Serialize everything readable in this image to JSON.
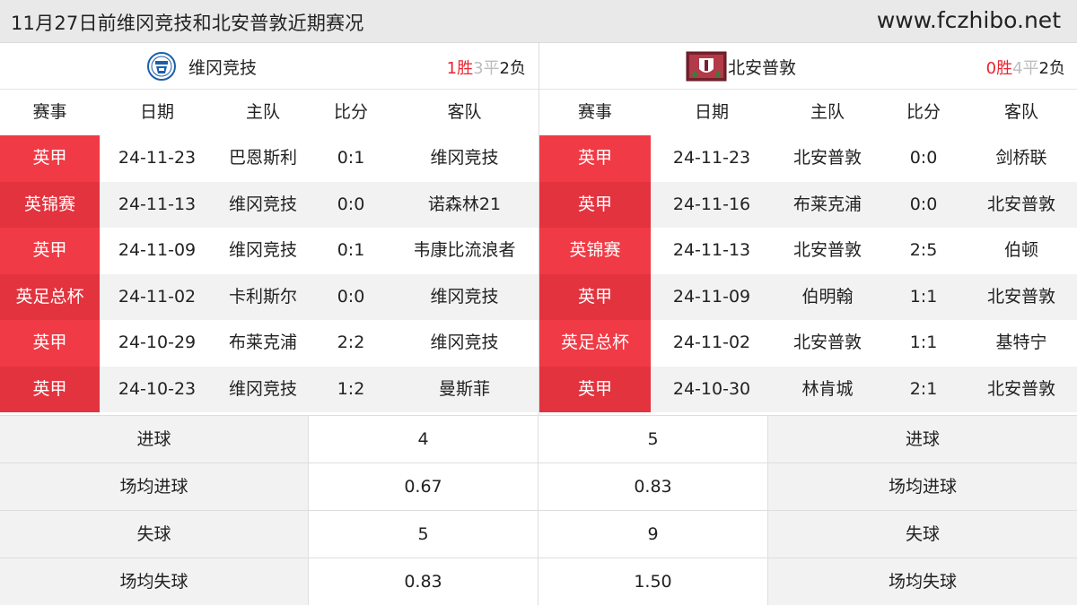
{
  "header": {
    "title": "11月27日前维冈竞技和北安普敦近期赛况",
    "site": "www.fczhibo.net"
  },
  "columns": [
    "赛事",
    "日期",
    "主队",
    "比分",
    "客队"
  ],
  "colors": {
    "league_bg": "#f03a45",
    "win": "#e8262f",
    "draw": "#bdbdbd"
  },
  "left_team": {
    "name": "维冈竞技",
    "logo_icon": "wigan-crest-icon",
    "record": {
      "w": "1",
      "w_label": "胜",
      "d": "3",
      "d_label": "平",
      "l": "2",
      "l_label": "负"
    },
    "matches": [
      {
        "league": "英甲",
        "date": "24-11-23",
        "home": "巴恩斯利",
        "score": "0:1",
        "away": "维冈竞技"
      },
      {
        "league": "英锦赛",
        "date": "24-11-13",
        "home": "维冈竞技",
        "score": "0:0",
        "away": "诺森林21"
      },
      {
        "league": "英甲",
        "date": "24-11-09",
        "home": "维冈竞技",
        "score": "0:1",
        "away": "韦康比流浪者"
      },
      {
        "league": "英足总杯",
        "date": "24-11-02",
        "home": "卡利斯尔",
        "score": "0:0",
        "away": "维冈竞技"
      },
      {
        "league": "英甲",
        "date": "24-10-29",
        "home": "布莱克浦",
        "score": "2:2",
        "away": "维冈竞技"
      },
      {
        "league": "英甲",
        "date": "24-10-23",
        "home": "维冈竞技",
        "score": "1:2",
        "away": "曼斯菲"
      }
    ]
  },
  "right_team": {
    "name": "北安普敦",
    "logo_icon": "northampton-crest-icon",
    "record": {
      "w": "0",
      "w_label": "胜",
      "d": "4",
      "d_label": "平",
      "l": "2",
      "l_label": "负"
    },
    "matches": [
      {
        "league": "英甲",
        "date": "24-11-23",
        "home": "北安普敦",
        "score": "0:0",
        "away": "剑桥联"
      },
      {
        "league": "英甲",
        "date": "24-11-16",
        "home": "布莱克浦",
        "score": "0:0",
        "away": "北安普敦"
      },
      {
        "league": "英锦赛",
        "date": "24-11-13",
        "home": "北安普敦",
        "score": "2:5",
        "away": "伯顿"
      },
      {
        "league": "英甲",
        "date": "24-11-09",
        "home": "伯明翰",
        "score": "1:1",
        "away": "北安普敦"
      },
      {
        "league": "英足总杯",
        "date": "24-11-02",
        "home": "北安普敦",
        "score": "1:1",
        "away": "基特宁"
      },
      {
        "league": "英甲",
        "date": "24-10-30",
        "home": "林肯城",
        "score": "2:1",
        "away": "北安普敦"
      }
    ]
  },
  "stats": [
    {
      "label": "进球",
      "left": "4",
      "right": "5"
    },
    {
      "label": "场均进球",
      "left": "0.67",
      "right": "0.83"
    },
    {
      "label": "失球",
      "left": "5",
      "right": "9"
    },
    {
      "label": "场均失球",
      "left": "0.83",
      "right": "1.50"
    }
  ]
}
